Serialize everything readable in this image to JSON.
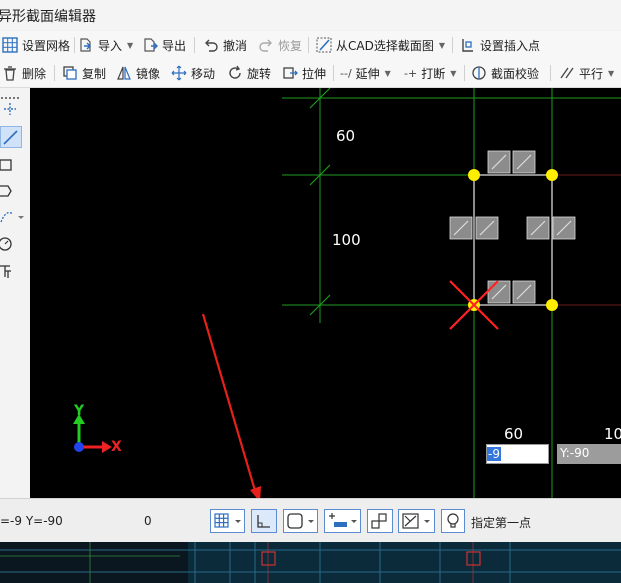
{
  "window": {
    "title": "异形截面编辑器"
  },
  "toolbar1": {
    "grid": "设置网格",
    "import": "导入",
    "export": "导出",
    "undo": "撤消",
    "redo": "恢复",
    "cad": "从CAD选择截面图",
    "insert_point": "设置插入点"
  },
  "toolbar2": {
    "delete": "删除",
    "copy": "复制",
    "mirror": "镜像",
    "move": "移动",
    "rotate": "旋转",
    "stretch": "拉伸",
    "extend": "延伸",
    "break": "打断",
    "check": "截面校验",
    "parallel": "平行"
  },
  "canvas": {
    "dim_top": "60",
    "dim_mid": "100",
    "dim_bottom_1": "60",
    "dim_bottom_2": "10",
    "axis_x": "X",
    "axis_y": "Y",
    "input_value": "-9",
    "y_field": "Y:-90"
  },
  "statusbar": {
    "coords": "=-9 Y=-90",
    "zero": "0",
    "prompt": "指定第一点"
  },
  "colors": {
    "grid": "#1f9a1f",
    "vertex": "#ffee00",
    "cursor": "#ff2222",
    "annotation_arrow": "#e8201c",
    "section_outline": "#c8c8c8",
    "rebar_box": "#8c8c8c"
  }
}
